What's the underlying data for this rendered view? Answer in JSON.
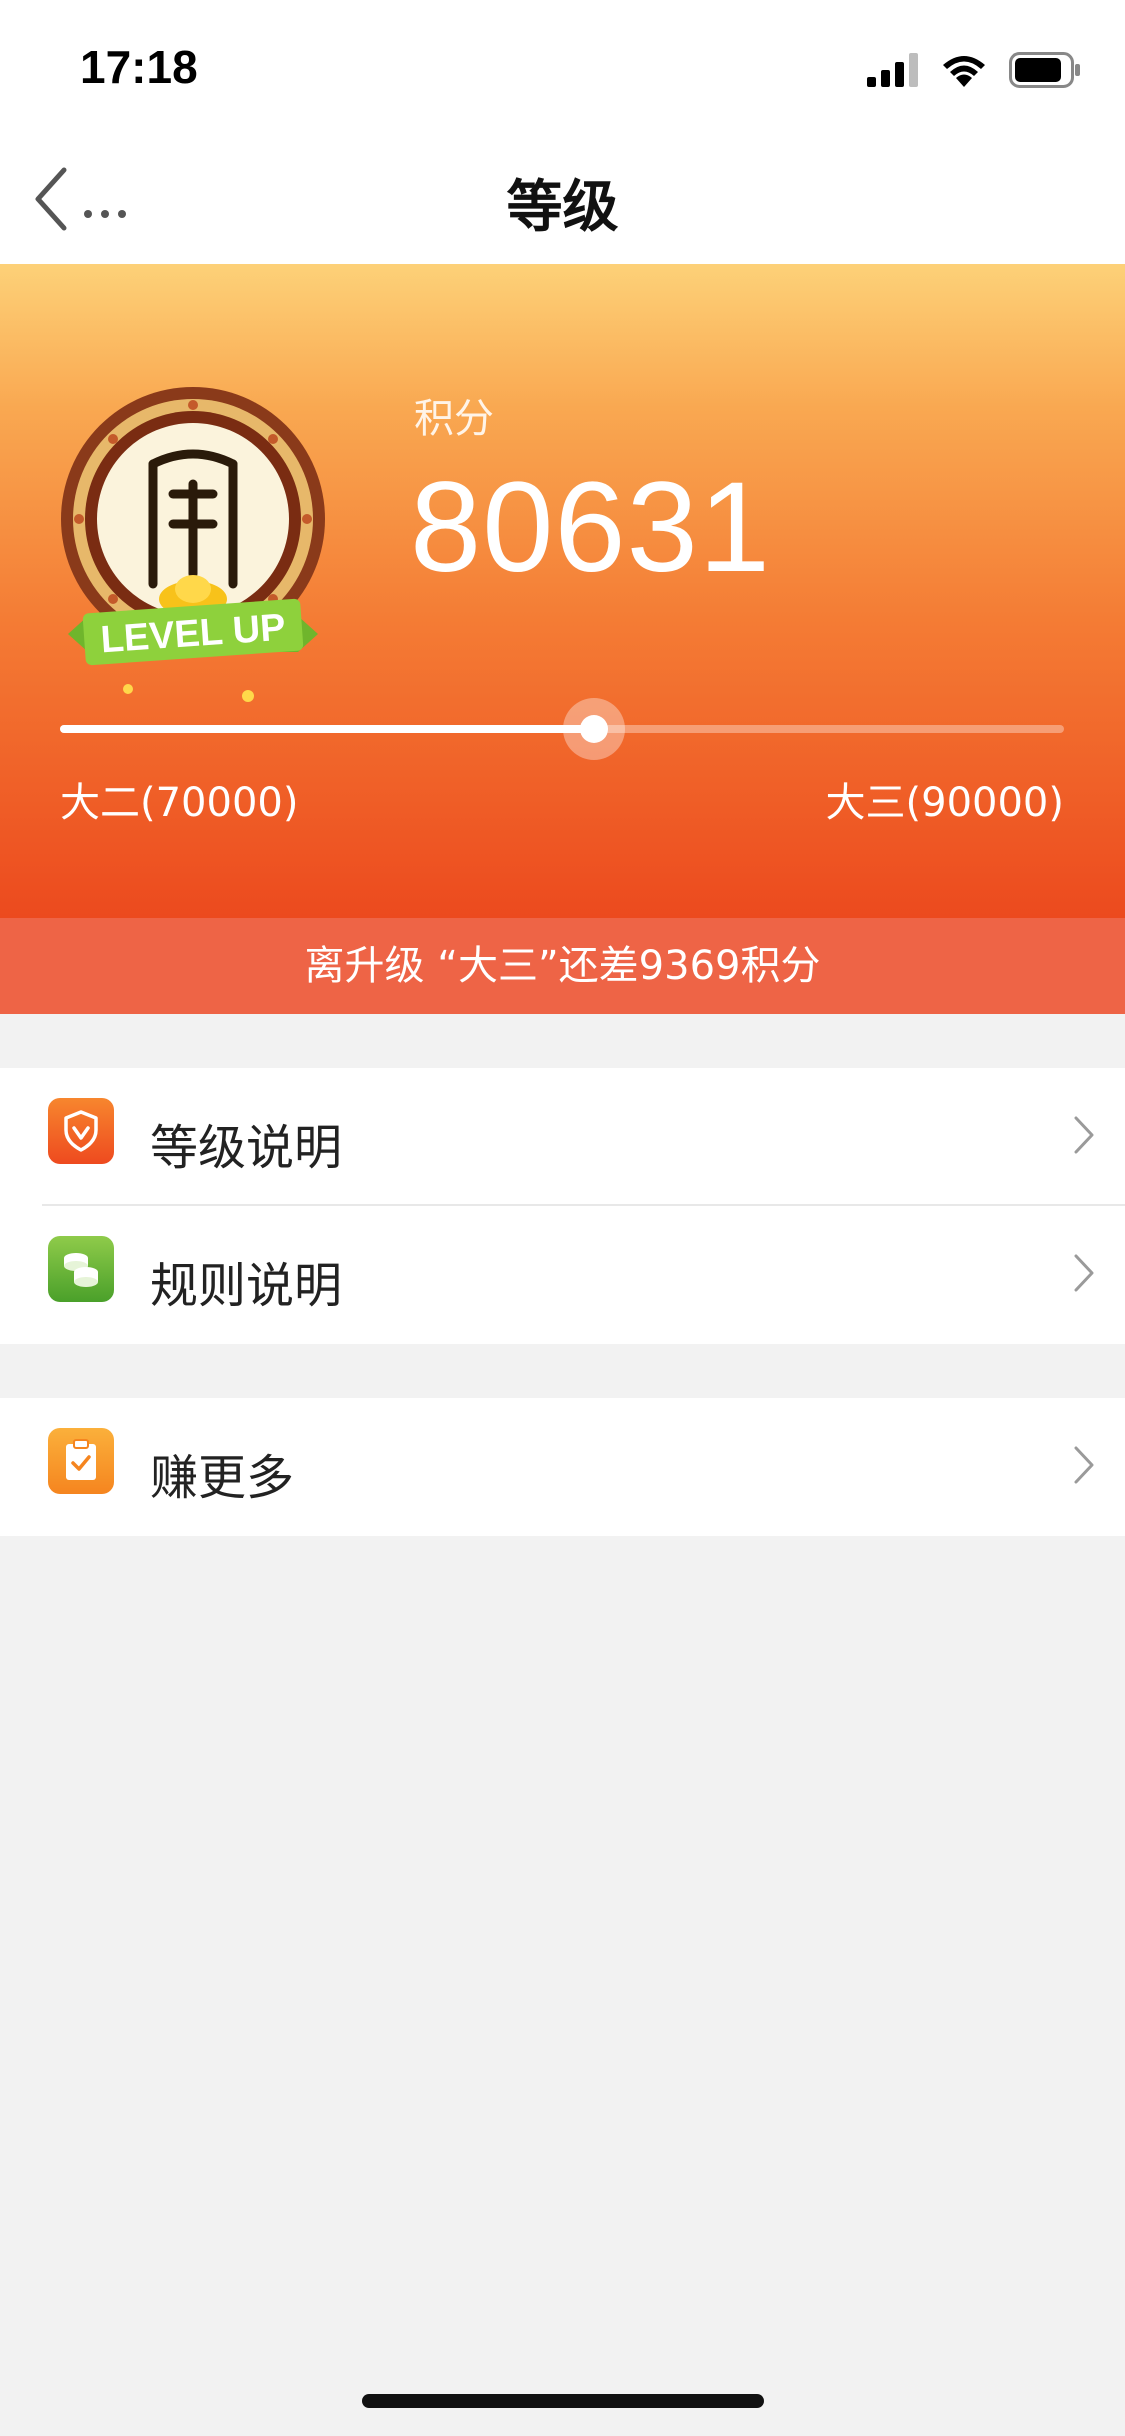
{
  "status_bar": {
    "time": "17:18"
  },
  "nav": {
    "title": "等级",
    "back_label": "..."
  },
  "hero": {
    "points_label": "积分",
    "points_value": "80631",
    "badge_text": "LEVEL UP",
    "progress_fraction": 0.5316,
    "current_level": "大二(70000)",
    "next_level": "大三(90000)"
  },
  "notice": "离升级 “大三”还差9369积分",
  "menu": {
    "group1": [
      {
        "label": "等级说明",
        "icon": "shield-icon"
      },
      {
        "label": "规则说明",
        "icon": "coins-icon"
      }
    ],
    "group2": [
      {
        "label": "赚更多",
        "icon": "clipboard-check-icon"
      }
    ]
  },
  "colors": {
    "hero_top": "#fdd178",
    "hero_bottom": "#ec4a1e",
    "notice_bg": "#ee6446",
    "page_bg": "#f2f2f2"
  }
}
